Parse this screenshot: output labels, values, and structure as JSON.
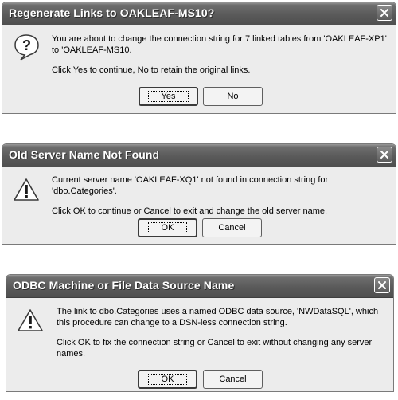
{
  "dialog1": {
    "title": "Regenerate Links to OAKLEAF-MS10?",
    "icon": "question-icon",
    "message": "You are about to change the connection string for 7 linked tables from 'OAKLEAF-XP1' to 'OAKLEAF-MS10.",
    "hint": "Click Yes to continue, No to retain the original links.",
    "yes_label": "Yes",
    "no_label": "No"
  },
  "dialog2": {
    "title": "Old Server Name Not Found",
    "icon": "warning-icon",
    "message": "Current server name 'OAKLEAF-XQ1' not found in connection string for 'dbo.Categories'.",
    "hint": "Click OK to continue or Cancel to exit and change the old server name.",
    "ok_label": "OK",
    "cancel_label": "Cancel"
  },
  "dialog3": {
    "title": "ODBC Machine or File Data Source Name",
    "icon": "warning-icon",
    "message": "The link to dbo.Categories uses a named ODBC data source, 'NWDataSQL', which this procedure can change to a DSN-less connection string.",
    "hint": "Click OK to fix the connection string or Cancel to exit without changing any server names.",
    "ok_label": "OK",
    "cancel_label": "Cancel"
  }
}
